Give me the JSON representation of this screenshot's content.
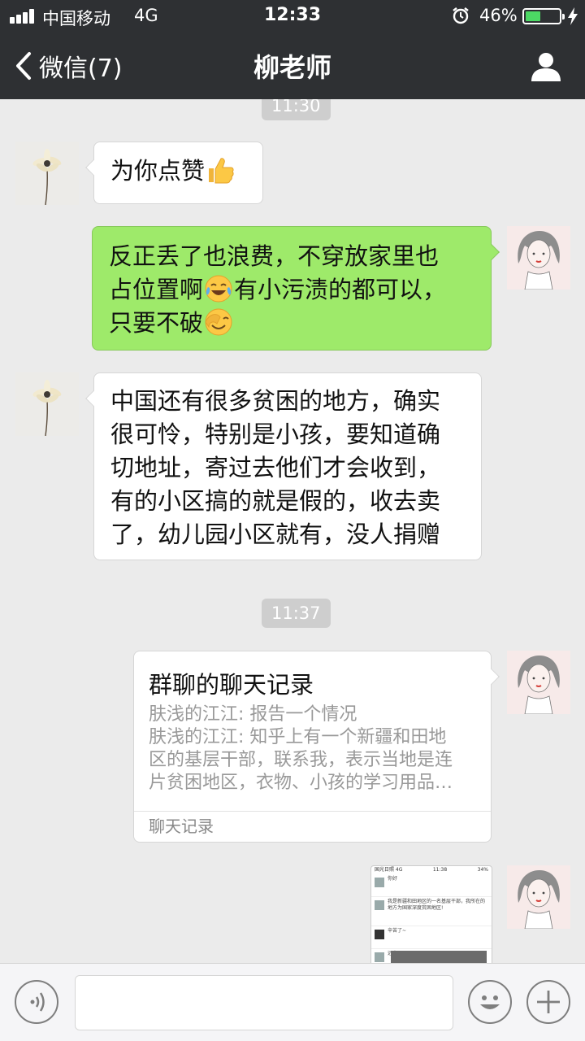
{
  "status_bar": {
    "carrier": "中国移动",
    "network": "4G",
    "time": "12:33",
    "battery_percent": "46%",
    "battery_level": 0.46,
    "icons": [
      "signal-icon",
      "alarm-icon",
      "battery-icon",
      "charging-icon"
    ]
  },
  "nav": {
    "back_label": "微信(7)",
    "title": "柳老师",
    "icons": [
      "chevron-left-icon",
      "person-icon"
    ]
  },
  "chat": {
    "times": [
      "11:30",
      "11:37"
    ],
    "messages": [
      {
        "side": "left",
        "text_before": "为你点赞",
        "emoji": "thumbs-up-icon"
      },
      {
        "side": "right",
        "line1": "反正丢了也浪费，不穿放家里也",
        "line2_a": "占位置啊",
        "emoji_a": "tears-of-joy-icon",
        "line2_b": "有小污渍的都可以，",
        "line3": "只要不破",
        "emoji_b": "face-palm-icon"
      },
      {
        "side": "left",
        "lines": [
          "中国还有很多贫困的地方，确实",
          "很可怜，特别是小孩，要知道确",
          "切地址，寄过去他们才会收到，",
          "有的小区搞的就是假的，收去卖",
          "了，幼儿园小区就有，没人捐赠"
        ]
      }
    ],
    "record_card": {
      "title": "群聊的聊天记录",
      "lines": [
        "肤浅的江江: 报告一个情况",
        "肤浅的江江: 知乎上有一个新疆和田地",
        "区的基层干部，联系我，表示当地是连",
        "片贫困地区，衣物、小孩的学习用品…"
      ],
      "footer": "聊天记录"
    },
    "screenshot_thumb": {
      "status_left": "国光日照 4G",
      "status_time": "11:38",
      "status_right": "34%",
      "rows": [
        "你好",
        "我是新疆和田地区的一名基层干部，我所在的地方为国家深度贫困地区!",
        "辛苦了~",
        "远方"
      ]
    }
  },
  "input_bar": {
    "placeholder": "",
    "icons": [
      "voice-icon",
      "emoji-face-icon",
      "plus-icon"
    ]
  }
}
